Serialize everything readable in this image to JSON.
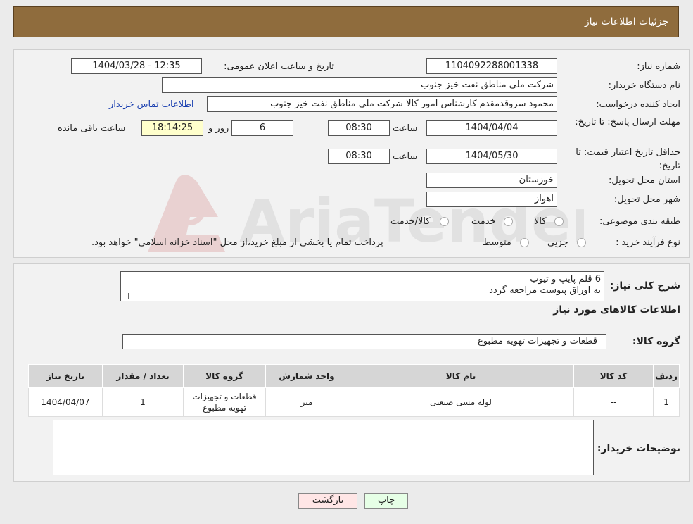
{
  "header": {
    "title": "جزئیات اطلاعات نیاز"
  },
  "form": {
    "need_number_label": "شماره نیاز:",
    "need_number": "1104092288001338",
    "announce_label": "تاریخ و ساعت اعلان عمومی:",
    "announce_value": "1404/03/28 - 12:35",
    "buyer_org_label": "نام دستگاه خریدار:",
    "buyer_org": "شرکت ملی مناطق نفت خیز جنوب",
    "creator_label": "ایجاد کننده درخواست:",
    "creator": "محمود سروقدمقدم کارشناس امور کالا شرکت ملی مناطق نفت خیز جنوب",
    "contact_link": "اطلاعات تماس خریدار",
    "deadline_label": "مهلت ارسال پاسخ: تا تاریخ:",
    "deadline_date": "1404/04/04",
    "time_label": "ساعت",
    "deadline_time": "08:30",
    "days_value": "6",
    "days_label": "روز و",
    "remaining_time": "18:14:25",
    "remaining_label": "ساعت باقی مانده",
    "validity_label": "حداقل تاریخ اعتبار قیمت: تا تاریخ:",
    "validity_date": "1404/05/30",
    "validity_time": "08:30",
    "province_label": "استان محل تحویل:",
    "province": "خوزستان",
    "city_label": "شهر محل تحویل:",
    "city": "اهواز",
    "category_label": "طبقه بندی موضوعی:",
    "category_options": [
      "کالا",
      "خدمت",
      "کالا/خدمت"
    ],
    "process_label": "نوع فرآیند خرید :",
    "process_options": [
      "جزیی",
      "متوسط"
    ],
    "process_note": "پرداخت تمام یا بخشی از مبلغ خرید،از محل \"اسناد خزانه اسلامی\" خواهد بود."
  },
  "summary": {
    "desc_label": "شرح کلی نیاز:",
    "desc_line1": "6 قلم پایپ و تیوب",
    "desc_line2": "به اوراق پیوست مراجعه گردد",
    "items_title": "اطلاعات کالاهای مورد نیاز",
    "group_label": "گروه کالا:",
    "group_value": "قطعات و تجهیزات تهویه مطبوع"
  },
  "table": {
    "headers": [
      "ردیف",
      "کد کالا",
      "نام کالا",
      "واحد شمارش",
      "گروه کالا",
      "تعداد / مقدار",
      "تاریخ نیاز"
    ],
    "rows": [
      [
        "1",
        "--",
        "لوله مسی صنعتی",
        "متر",
        "قطعات و تجهیزات تهویه مطبوع",
        "1",
        "1404/04/07"
      ]
    ]
  },
  "buyer_notes_label": "توضیحات خریدار:",
  "buttons": {
    "print": "چاپ",
    "back": "بازگشت"
  },
  "colors": {
    "header_bg": "#8f6c3d",
    "print_bg": "#e6ffe6",
    "back_bg": "#ffe6e6"
  }
}
